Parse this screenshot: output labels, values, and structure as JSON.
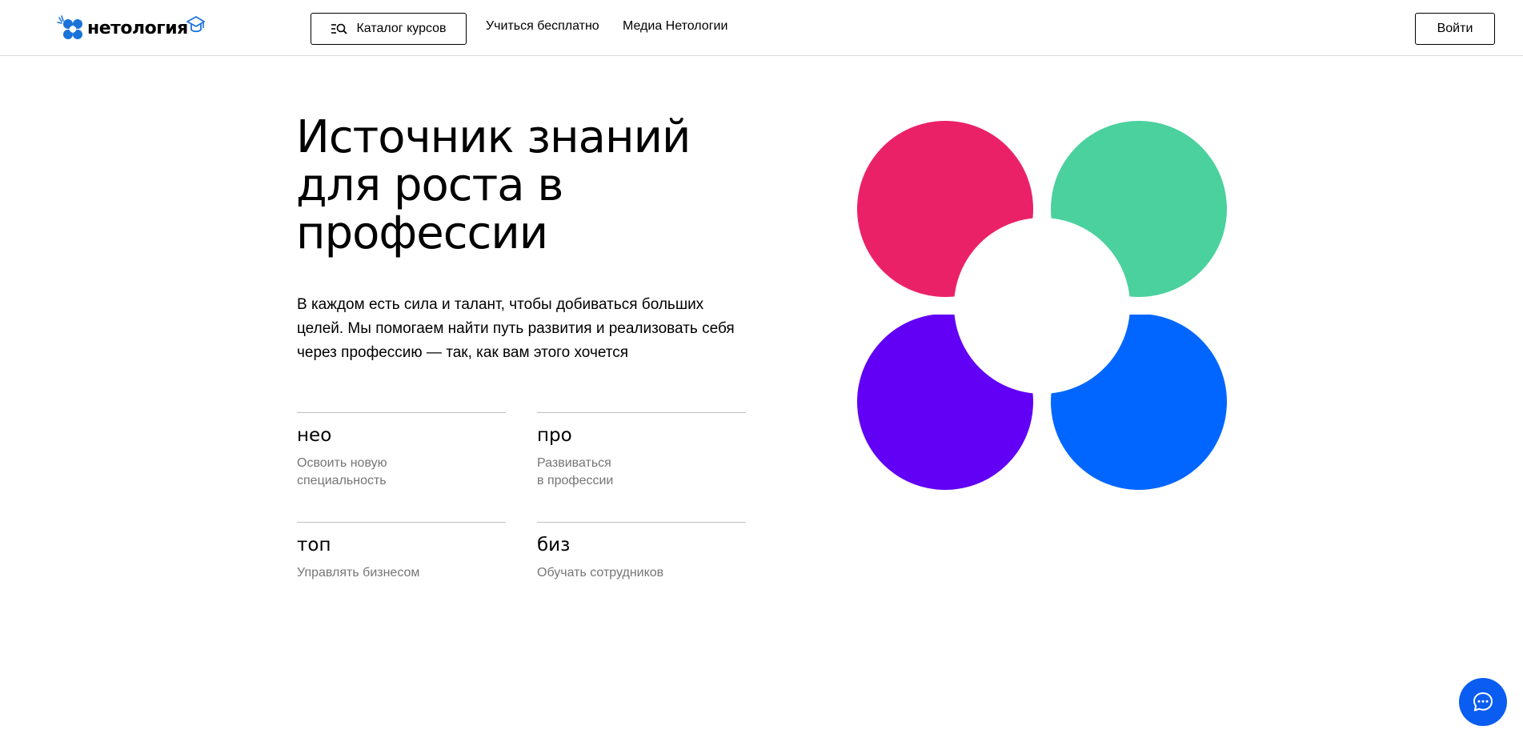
{
  "header": {
    "logo_text": "нетология",
    "catalog_label": "Каталог курсов",
    "nav": [
      "Учиться бесплатно",
      "Медиа Нетологии"
    ],
    "login_label": "Войти"
  },
  "hero": {
    "title_lines": [
      "Источник знаний",
      "для роста в",
      "профессии"
    ],
    "description": "В каждом есть сила и талант, чтобы добиваться больших целей. Мы помогаем найти путь развития и реализовать себя через профессию — так, как вам этого хочется"
  },
  "cards": [
    {
      "title": "нео",
      "subtitle": "Освоить новую\nспециальность"
    },
    {
      "title": "про",
      "subtitle": "Развиваться\nв профессии"
    },
    {
      "title": "топ",
      "subtitle": "Управлять бизнесом"
    },
    {
      "title": "биз",
      "subtitle": "Обучать сотрудников"
    }
  ],
  "colors": {
    "petal_top_left": "#eb2168",
    "petal_top_right": "#4bd19d",
    "petal_bottom_left": "#6100f5",
    "petal_bottom_right": "#0066ff",
    "chat_button": "#0a5df0",
    "logo_blue": "#1a73d9"
  },
  "icons": {
    "catalog": "catalog-search-icon",
    "chat": "chat-bubble-icon"
  }
}
